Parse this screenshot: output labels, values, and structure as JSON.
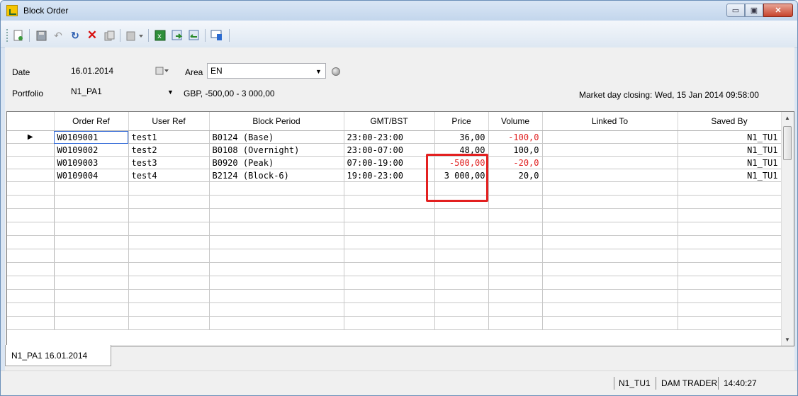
{
  "window": {
    "title": "Block Order",
    "minimize": "▭",
    "maximize": "▣",
    "close": "✕"
  },
  "toolbar": {
    "icons": [
      "new-icon",
      "save-icon",
      "undo-icon",
      "refresh-icon",
      "delete-icon",
      "copy-icon",
      "paste-dropdown-icon",
      "export-excel-icon",
      "import-icon",
      "transfer-icon",
      "comment-icon"
    ]
  },
  "filters": {
    "date_label": "Date",
    "date_value": "16.01.2014",
    "area_label": "Area",
    "area_value": "EN",
    "portfolio_label": "Portfolio",
    "portfolio_value": "N1_PA1",
    "portfolio_info": "GBP, -500,00 - 3 000,00",
    "market_closing": "Market day closing: Wed, 15 Jan 2014 09:58:00"
  },
  "grid": {
    "columns": [
      "Order Ref",
      "User Ref",
      "Block Period",
      "GMT/BST",
      "Price",
      "Volume",
      "Linked To",
      "Saved By"
    ],
    "rows": [
      {
        "order_ref": "W0109001",
        "user_ref": "test1",
        "block_period": "B0124 (Base)",
        "gmt": "23:00-23:00",
        "price": "36,00",
        "volume": "-100,0",
        "linked_to": "",
        "saved_by": "N1_TU1"
      },
      {
        "order_ref": "W0109002",
        "user_ref": "test2",
        "block_period": "B0108 (Overnight)",
        "gmt": "23:00-07:00",
        "price": "48,00",
        "volume": "100,0",
        "linked_to": "",
        "saved_by": "N1_TU1"
      },
      {
        "order_ref": "W0109003",
        "user_ref": "test3",
        "block_period": "B0920 (Peak)",
        "gmt": "07:00-19:00",
        "price": "-500,00",
        "volume": "-20,0",
        "linked_to": "",
        "saved_by": "N1_TU1"
      },
      {
        "order_ref": "W0109004",
        "user_ref": "test4",
        "block_period": "B2124 (Block-6)",
        "gmt": "19:00-23:00",
        "price": "3 000,00",
        "volume": "20,0",
        "linked_to": "",
        "saved_by": "N1_TU1"
      }
    ]
  },
  "tab": {
    "label": "N1_PA1 16.01.2014"
  },
  "status": {
    "user": "N1_TU1",
    "role": "DAM TRADER",
    "time": "14:40:27"
  }
}
